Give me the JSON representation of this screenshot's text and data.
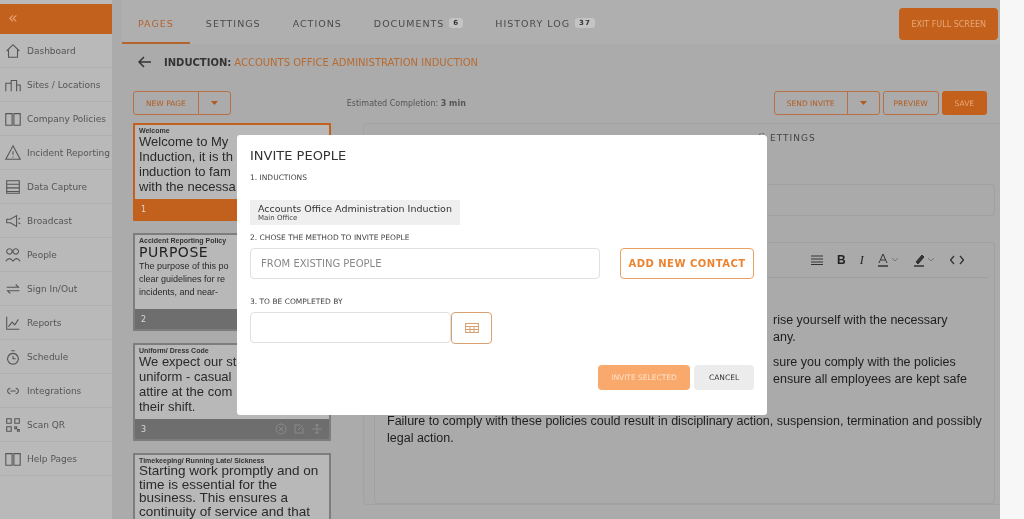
{
  "sidebar": {
    "collapse_label": "«",
    "items": [
      {
        "label": "Dashboard"
      },
      {
        "label": "Sites / Locations"
      },
      {
        "label": "Company Policies"
      },
      {
        "label": "Incident Reporting"
      },
      {
        "label": "Data Capture"
      },
      {
        "label": "Broadcast"
      },
      {
        "label": "People"
      },
      {
        "label": "Sign In/Out"
      },
      {
        "label": "Reports"
      },
      {
        "label": "Schedule"
      },
      {
        "label": "Integrations"
      },
      {
        "label": "Scan QR"
      },
      {
        "label": "Help Pages"
      }
    ]
  },
  "tabs": [
    {
      "label": "PAGES",
      "selected": true
    },
    {
      "label": "SETTINGS",
      "selected": false
    },
    {
      "label": "ACTIONS",
      "selected": false
    },
    {
      "label": "DOCUMENTS",
      "selected": false,
      "badge": "6"
    },
    {
      "label": "HISTORY LOG",
      "selected": false,
      "badge": "37"
    }
  ],
  "exit_button": "EXIT FULL SCREEN",
  "breadcrumb": {
    "prefix": "INDUCTION:",
    "title": "ACCOUNTS OFFICE ADMINISTRATION INDUCTION"
  },
  "toolbar": {
    "new_page": "NEW PAGE",
    "estimate": "Estimated Completion: **3 min**",
    "send_invite": "SEND INVITE",
    "preview": "PREVIEW",
    "save": "SAVE"
  },
  "pages": [
    {
      "title": "Welcome",
      "kind": "text",
      "selected": true,
      "lines": [
        "Welcome to My",
        "Induction, it is th",
        "induction to fam",
        "with the necessa"
      ],
      "number": "1"
    },
    {
      "title": "Accident Reporting Policy",
      "kind": "heading",
      "heading": "PURPOSE",
      "selected": false,
      "lines": [
        "The purpose of this po",
        "clear guidelines for re",
        "incidents, and near-"
      ],
      "number": "2"
    },
    {
      "title": "Uniform/ Dress Code",
      "kind": "text",
      "selected": false,
      "lines": [
        "We expect our st",
        "uniform - casual",
        "attire at the com",
        "their shift."
      ],
      "number": "3",
      "actions": true
    },
    {
      "title": "Timekeeping/ Running Late/ Sickness",
      "kind": "text",
      "selected": false,
      "lines": [
        "Starting work promptly and on",
        "time is essential for the",
        "business. This ensures a",
        "continuity of service and that"
      ]
    }
  ],
  "editor": {
    "tab_label": "ETTINGS",
    "format_buttons": [
      "B",
      "I"
    ],
    "paragraphs": [
      {
        "lines": [
          {
            "text": "rise yourself with the necessary",
            "clipped": true
          },
          {
            "text": "any.",
            "clipped": true
          }
        ]
      },
      {
        "lines": [
          {
            "text": "sure you comply with the policies",
            "clipped": true
          },
          {
            "text": "ensure all employees are kept safe",
            "clipped": true
          }
        ]
      },
      {
        "lines": [
          {
            "text": "Failure to comply with these policies could result in disciplinary action, suspension, termination and possibly"
          },
          {
            "text": "legal action."
          }
        ]
      }
    ]
  },
  "dialog": {
    "title": "INVITE PEOPLE",
    "step1": "1. INDUCTIONS",
    "induction": {
      "name": "Accounts Office Administration Induction",
      "site": "Main Office"
    },
    "step2": "2. CHOSE THE METHOD TO INVITE PEOPLE",
    "people_placeholder": "FROM EXISTING PEOPLE",
    "add_contact": "ADD NEW CONTACT",
    "step3": "3. TO BE COMPLETED BY",
    "invite": "INVITE SELECTED",
    "cancel": "CANCEL"
  }
}
